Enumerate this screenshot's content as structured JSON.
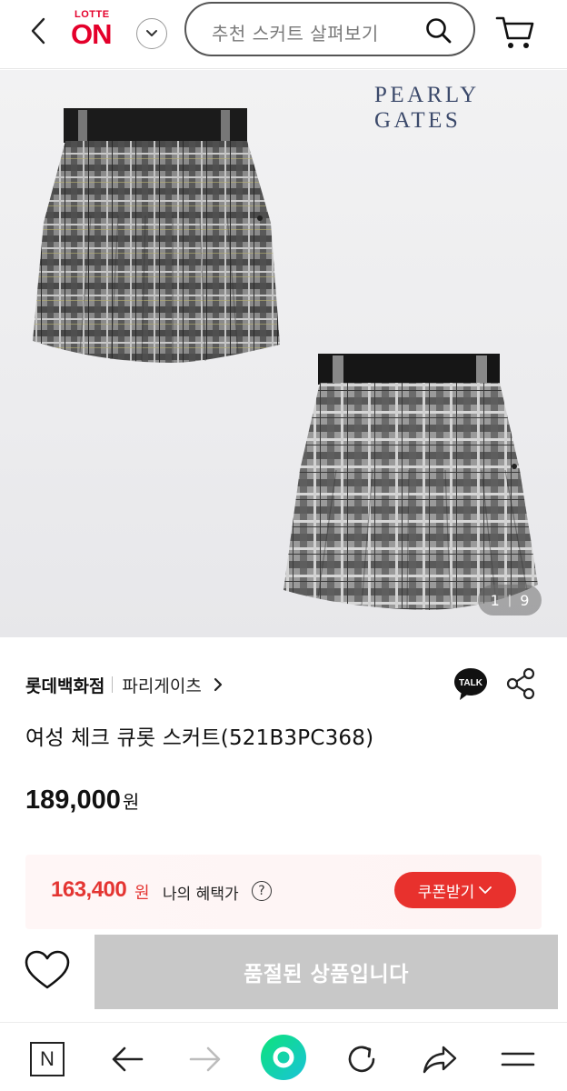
{
  "header": {
    "logo_top": "LOTTE",
    "logo_main": "ON",
    "search_placeholder": "추천 스커트 살펴보기"
  },
  "gallery": {
    "brand_mark": "PEARLY GATES",
    "page_current": "1",
    "page_total": "9"
  },
  "product": {
    "seller": "롯데백화점",
    "brand": "파리게이츠",
    "title": "여성 체크 큐롯 스커트(521B3PC368)",
    "price": "189,000",
    "price_unit": "원",
    "talk_label": "TALK"
  },
  "benefit": {
    "price": "163,400",
    "unit": "원",
    "label": "나의 혜택가",
    "help": "?",
    "coupon_label": "쿠폰받기"
  },
  "actions": {
    "soldout_label": "품절된 상품입니다"
  },
  "browser_bar": {
    "home_letter": "N"
  },
  "colors": {
    "brand_red": "#e4002b",
    "benefit_red": "#e43532",
    "soldout_gray": "#c8c8c8"
  }
}
